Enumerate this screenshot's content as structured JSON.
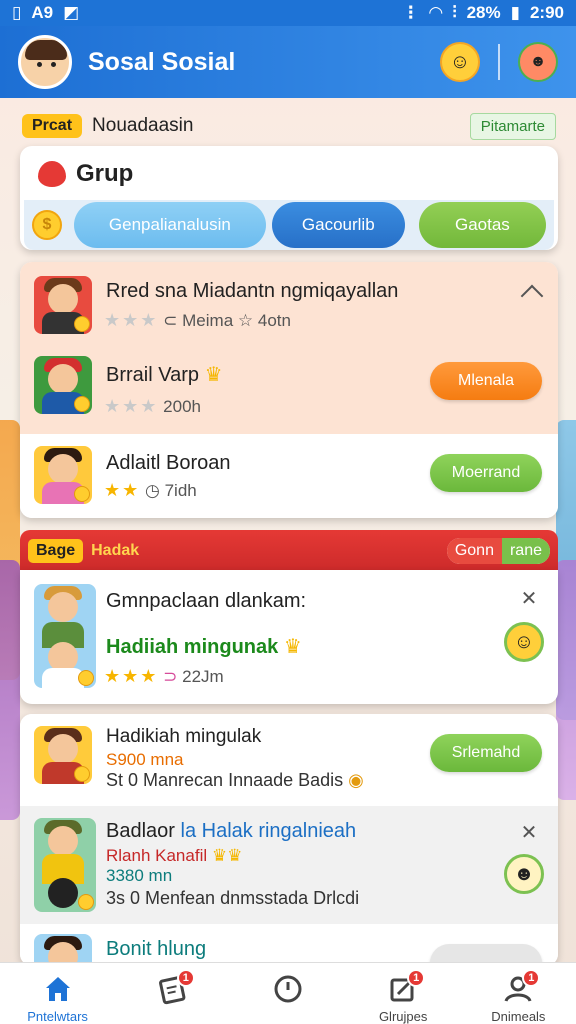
{
  "status_bar": {
    "left_icons": [
      "sim-icon",
      "wifi-icon",
      "photo-icon"
    ],
    "left_text": "A9",
    "battery": "28%",
    "time": "2:90"
  },
  "header": {
    "title": "Sosal Sosial"
  },
  "filter": {
    "badge": "Prcat",
    "text": "Nouadaasin",
    "right_label": "Pitamarte"
  },
  "grup": {
    "title": "Grup",
    "tabs": [
      "Genpalianalusin",
      "Gacourlib",
      "Gaotas"
    ]
  },
  "list1": {
    "header": {
      "title": "Rred sna Miadantn ngmiqayallan",
      "meta": "Meima",
      "meta2": "4otn"
    },
    "items": [
      {
        "title": "Brrail Varp",
        "sub": "200h",
        "button": "Mlenala"
      },
      {
        "title": "Adlaitl Boroan",
        "sub": "7idh",
        "button": "Moerrand"
      }
    ]
  },
  "red_section": {
    "tag": "Bage",
    "tag2": "Hadak",
    "right_a": "Gonn",
    "right_b": "rane"
  },
  "feature": {
    "title": "Gmnpaclaan dlankam:",
    "subtitle": "Hadiiah mingunak",
    "sub": "22Jm"
  },
  "list2": {
    "items": [
      {
        "title": "Hadikiah mingulak",
        "line2": "S900 mna",
        "line3": "St 0 Manrecan Innaade Badis",
        "button": "Srlemahd"
      },
      {
        "title_a": "Badlaor",
        "title_b": "la Halak ringalnieah",
        "line2": "Rlanh Kanafil",
        "line3": "3380 mn",
        "line4": "3s 0 Menfean dnmsstada Drlcdi"
      },
      {
        "title": "Bonit hlung"
      }
    ]
  },
  "bottom_nav": [
    {
      "label": "Pntelwtars",
      "icon": "home-icon",
      "active": true,
      "badge": ""
    },
    {
      "label": "",
      "icon": "note-icon",
      "active": false,
      "badge": "1"
    },
    {
      "label": "",
      "icon": "clock-icon",
      "active": false,
      "badge": ""
    },
    {
      "label": "Glrujpes",
      "icon": "edit-icon",
      "active": false,
      "badge": "1"
    },
    {
      "label": "Dnimeals",
      "icon": "people-icon",
      "active": false,
      "badge": "1"
    }
  ],
  "colors": {
    "primary": "#1e73d6",
    "accent_orange": "#f57c11",
    "accent_green": "#6bb83b",
    "alert_red": "#e53935"
  }
}
